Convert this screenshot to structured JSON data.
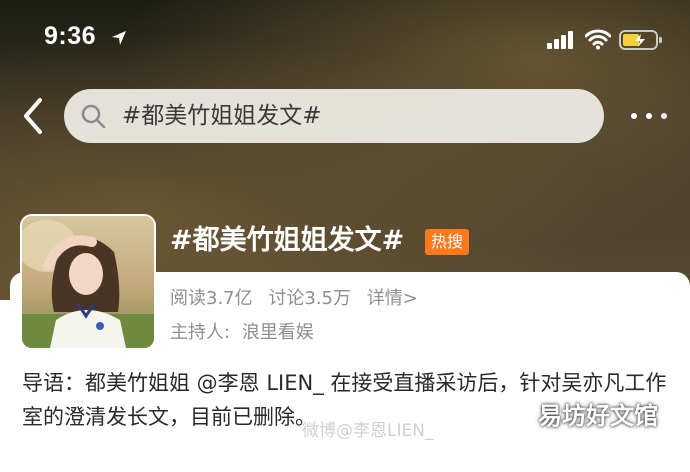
{
  "status_bar": {
    "time": "9:36"
  },
  "nav": {
    "search_query": "#都美竹姐姐发文#"
  },
  "topic": {
    "title": "#都美竹姐姐发文#",
    "badge": "热搜",
    "reads": "阅读3.7亿",
    "discussions": "讨论3.5万",
    "details": "详情>",
    "host_label": "主持人:",
    "host_name": "浪里看娱"
  },
  "intro": {
    "text": "导语：都美竹姐姐 @李恩 LIEN_ 在接受直播采访后，针对吴亦凡工作室的澄清发长文，目前已删除。"
  },
  "watermarks": {
    "center": "微博@李恩LIEN_",
    "logo": "易坊好文馆"
  },
  "colors": {
    "badge": "#ff7a1a",
    "secondary_text": "#8f8f8f",
    "body_text": "#2a2a2a"
  },
  "icons": [
    "location-arrow-icon",
    "signal-icon",
    "wifi-icon",
    "battery-icon",
    "back-arrow-icon",
    "search-icon",
    "more-icon"
  ],
  "battery_level": 0.5
}
